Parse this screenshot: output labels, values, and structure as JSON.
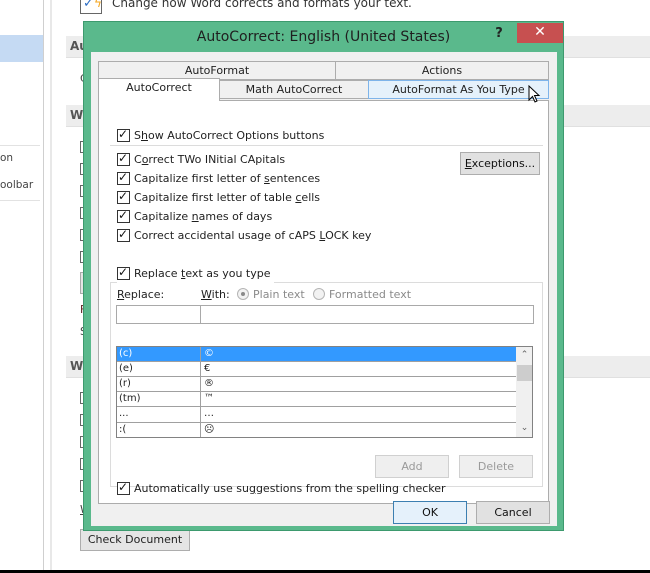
{
  "background_window": {
    "top_text": "Change how Word corrects and formats your text.",
    "sidebar_items": [
      "on",
      "oolbar"
    ],
    "section_headers": [
      "Au",
      "W",
      "W"
    ],
    "partial_labels": [
      "C",
      "F",
      "S",
      "W"
    ],
    "check_document_button": "Check Document"
  },
  "dialog": {
    "title": "AutoCorrect: English (United States)",
    "help_label": "?",
    "close_label": "✕",
    "tabs_row1": [
      {
        "label": "AutoFormat"
      },
      {
        "label": "Actions"
      }
    ],
    "tabs_row2": [
      {
        "label": "AutoCorrect",
        "active": true
      },
      {
        "label": "Math AutoCorrect",
        "active": false
      },
      {
        "label": "AutoFormat As You Type",
        "active": false,
        "hover": true
      }
    ],
    "show_options": {
      "pre": "S",
      "u": "h",
      "post": "ow AutoCorrect Options buttons",
      "checked": true
    },
    "options": [
      {
        "pre": "C",
        "u": "o",
        "post": "rrect TWo INitial CApitals",
        "checked": true
      },
      {
        "pre": "Capitalize first letter of ",
        "u": "s",
        "post": "entences",
        "checked": true
      },
      {
        "pre": "Capitalize first letter of table ",
        "u": "c",
        "post": "ells",
        "checked": true
      },
      {
        "pre": "Capitalize ",
        "u": "n",
        "post": "ames of days",
        "checked": true
      },
      {
        "pre": "Correct accidental usage of cAPS ",
        "u": "L",
        "post": "OCK key",
        "checked": true
      }
    ],
    "exceptions_button": {
      "u": "E",
      "post": "xceptions..."
    },
    "replace_as_you_type": {
      "pre": "Replace ",
      "u": "t",
      "post": "ext as you type",
      "checked": true
    },
    "replace_label": {
      "u": "R",
      "post": "eplace:"
    },
    "with_label": {
      "u": "W",
      "post": "ith:"
    },
    "radio_plain": {
      "label": "Plain text",
      "selected": true,
      "disabled": true
    },
    "radio_formatted": {
      "label": "Formatted text",
      "selected": false,
      "disabled": true
    },
    "replace_input_value": "",
    "with_input_value": "",
    "entries": [
      {
        "replace": "(c)",
        "with": "©",
        "selected": true
      },
      {
        "replace": "(e)",
        "with": "€",
        "selected": false
      },
      {
        "replace": "(r)",
        "with": "®",
        "selected": false
      },
      {
        "replace": "(tm)",
        "with": "™",
        "selected": false
      },
      {
        "replace": "...",
        "with": "…",
        "selected": false
      },
      {
        "replace": ":(",
        "with": "☹",
        "selected": false
      }
    ],
    "scroll_up": "⌃",
    "scroll_down": "⌄",
    "add_button": "Add",
    "delete_button": "Delete",
    "spelling_suggestions": {
      "pre": "Automatically use su",
      "u": "g",
      "post": "gestions from the spelling checker",
      "checked": true
    },
    "ok_button": "OK",
    "cancel_button": "Cancel"
  },
  "colors": {
    "dialog_frame": "#5ab98c",
    "close_button": "#c75050",
    "selection": "#3399ff",
    "tab_hover": "#e5f1fb"
  }
}
